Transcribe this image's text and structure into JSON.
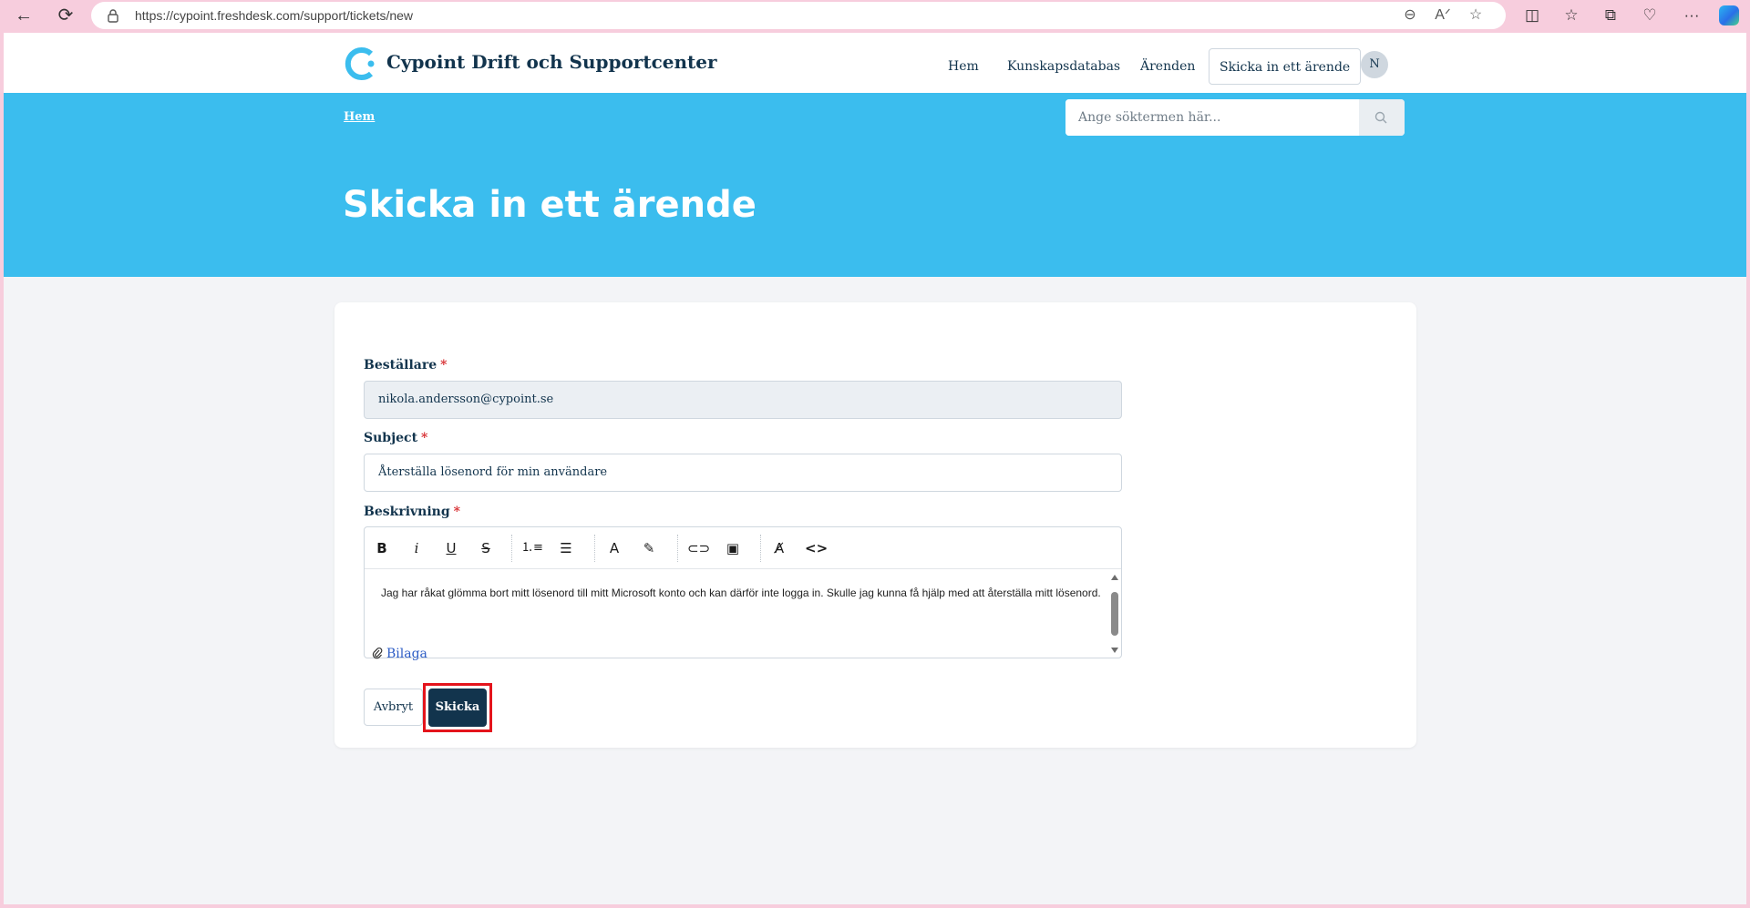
{
  "browser": {
    "url": "https://cypoint.freshdesk.com/support/tickets/new"
  },
  "site": {
    "title": "Cypoint Drift och Supportcenter",
    "nav": [
      "Hem",
      "Kunskapsdatabas",
      "Ärenden",
      "Skicka in ett ärende"
    ],
    "avatar_initial": "N",
    "brand_color": "#3bbdee",
    "primary_color": "#12344d"
  },
  "hero": {
    "breadcrumb": "Hem",
    "search_placeholder": "Ange söktermen här...",
    "title": "Skicka in ett ärende"
  },
  "form": {
    "requester_label": "Beställare",
    "requester_value": "nikola.andersson@cypoint.se",
    "subject_label": "Subject",
    "subject_value": "Återställa lösenord för min användare",
    "description_label": "Beskrivning",
    "required_mark": "*",
    "description_text": "Jag har råkat glömma bort mitt lösenord till mitt Microsoft konto och kan därför inte logga in. Skulle jag kunna få hjälp med att återställa mitt lösenord.",
    "toolbar": [
      "bold-icon",
      "italic-icon",
      "underline-icon",
      "strikethrough-icon",
      "numbered-list-icon",
      "bulleted-list-icon",
      "text-color-icon",
      "highlight-icon",
      "link-icon",
      "image-icon",
      "clear-format-icon",
      "code-view-icon"
    ],
    "attachment_label": "Bilaga",
    "cancel_label": "Avbryt",
    "submit_label": "Skicka",
    "highlight_color": "#e4141c"
  }
}
